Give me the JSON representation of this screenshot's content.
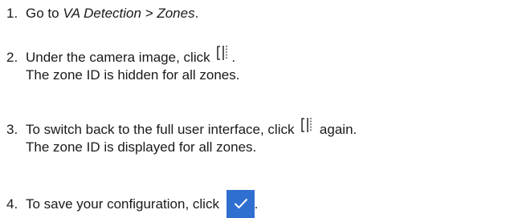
{
  "steps": [
    {
      "number": "1.",
      "text_before": "Go to ",
      "nav_path": "VA Detection > Zones",
      "text_after": "."
    },
    {
      "number": "2.",
      "text_before": "Under the camera image, click ",
      "icon": "compact-view-icon",
      "text_after": ".",
      "result": "The zone ID is hidden for all zones."
    },
    {
      "number": "3.",
      "text_before": "To switch back to the full user interface, click ",
      "icon": "compact-view-icon",
      "text_after": " again.",
      "result": "The zone ID is displayed for all zones."
    },
    {
      "number": "4.",
      "text_before": "To save your configuration, click ",
      "icon": "checkmark-icon",
      "text_after": "."
    }
  ],
  "colors": {
    "text": "#1a1a1a",
    "save_button_bg": "#2f6fd0",
    "icon_stroke": "#333333"
  }
}
